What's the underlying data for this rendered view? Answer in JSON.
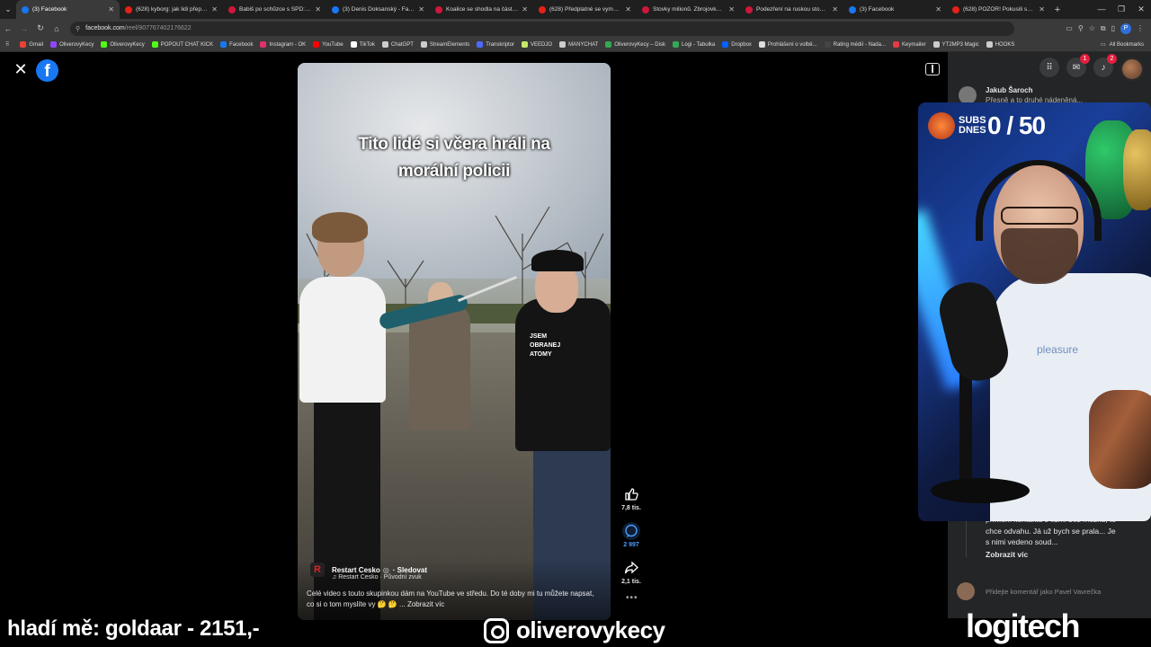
{
  "browser": {
    "tabs": [
      {
        "title": "(3) Facebook",
        "favicon_color": "#1877f2",
        "active": true
      },
      {
        "title": "(628) kyborg: jak lidi přepisuj",
        "favicon_color": "#e62117"
      },
      {
        "title": "Babiš po schůzce s SPD: Škrt",
        "favicon_color": "#d0163c"
      },
      {
        "title": "(3) Denis Doksanský - Fakta v",
        "favicon_color": "#1877f2"
      },
      {
        "title": "Koalice se shodla na částečné",
        "favicon_color": "#d0163c"
      },
      {
        "title": "(628) Předplatné se vymykají",
        "favicon_color": "#e62117"
      },
      {
        "title": "Stovky milionů. Zbrojovka od",
        "favicon_color": "#d0163c"
      },
      {
        "title": "Podezření na ruskou stopu sil",
        "favicon_color": "#d0163c"
      },
      {
        "title": "(3) Facebook",
        "favicon_color": "#1877f2"
      },
      {
        "title": "(628) POZOR! Pokusili se don",
        "favicon_color": "#e62117"
      }
    ],
    "new_tab": "+",
    "url_host": "facebook.com",
    "url_path": "/reel/907767402176622"
  },
  "bookmarks": [
    {
      "label": "Gmail",
      "color": "#ea4335"
    },
    {
      "label": "OliverovyKecy",
      "color": "#9146ff"
    },
    {
      "label": "OliverovyKecy",
      "color": "#53fc18"
    },
    {
      "label": "POPOUT CHAT KICK",
      "color": "#53fc18"
    },
    {
      "label": "Facebook",
      "color": "#1877f2"
    },
    {
      "label": "Instagram - OK",
      "color": "#e1306c"
    },
    {
      "label": "YouTube",
      "color": "#ff0000"
    },
    {
      "label": "TikTok",
      "color": "#ffffff"
    },
    {
      "label": "ChatGPT",
      "color": "#cccccc"
    },
    {
      "label": "StreamElements",
      "color": "#cccccc"
    },
    {
      "label": "Transkriptor",
      "color": "#4b6bff"
    },
    {
      "label": "VEEDJO",
      "color": "#c8e86b"
    },
    {
      "label": "MANYCHAT",
      "color": "#cccccc"
    },
    {
      "label": "OliverovyKecy – Disk",
      "color": "#34a853"
    },
    {
      "label": "Logi - Tabulka",
      "color": "#34a853"
    },
    {
      "label": "Dropbox",
      "color": "#0061ff"
    },
    {
      "label": "Prohlášení o volbě...",
      "color": "#dddddd"
    },
    {
      "label": "Rating médií - Nada...",
      "color": "#444444"
    },
    {
      "label": "Keymailer",
      "color": "#e63946"
    },
    {
      "label": "YT2MP3 Magic",
      "color": "#cccccc"
    },
    {
      "label": "HOOKS",
      "color": "#cccccc"
    }
  ],
  "all_bookmarks": "All Bookmarks",
  "facebook": {
    "logo": "f",
    "reel": {
      "caption_line1": "Tito lidé si včera hráli na",
      "caption_line2": "morální policii",
      "shirt_text": "JSEM OBRANEJ ATOMY",
      "author": "Restart Cesko",
      "follow": "· Sledovat",
      "audio": "♫ Restart Cesko · Původní zvuk",
      "description": "Celé video s touto skupinkou dám na YouTube ve středu. Do té doby mi tu můžete napsat, co si o tom myslíte vy 🤔 🤔 ... Zobrazit víc"
    },
    "actions": {
      "likes": "7,8 tis.",
      "comments": "2 997",
      "shares": "2,1 tis."
    },
    "notifications": {
      "messenger": "1",
      "bell": "2"
    },
    "comment_top": {
      "name": "Jakub Šaroch",
      "text": "Přesně a to druhé nádeněná..."
    },
    "comment_bottom": {
      "text": "přímém kontaktu s lidmi bez mozku, to chce odvahu. Já už bych se prala... Je s nimi vedeno soud...",
      "show_more": "Zobrazit víc"
    },
    "comment_placeholder": "Přidejte komentář jako Pavel Vavrečka"
  },
  "stream": {
    "subs_label": "SUBS DNES",
    "subs_count": "0 / 50",
    "cam_brand": "pleasure",
    "ticker": "hladí mě: goldaar - 2151,-",
    "instagram": "oliverovykecy",
    "sponsor": "logitech"
  }
}
